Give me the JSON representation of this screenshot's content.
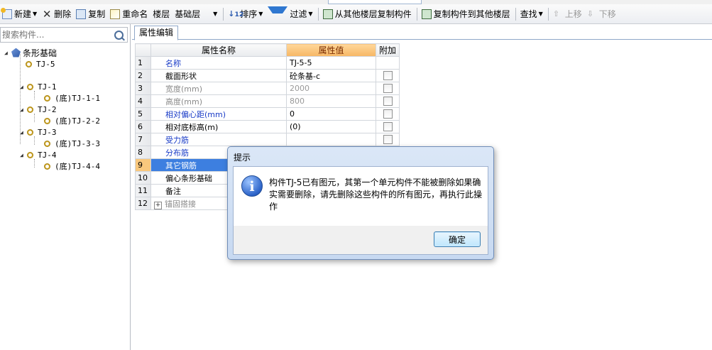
{
  "toolbar": {
    "new_label": "新建",
    "delete_label": "删除",
    "copy_label": "复制",
    "rename_label": "重命名",
    "floor_label": "楼层",
    "floor_value": "基础层",
    "sort_label": "排序",
    "filter_label": "过滤",
    "copy_from_label": "从其他楼层复制构件",
    "copy_to_label": "复制构件到其他楼层",
    "find_label": "查找",
    "up_label": "上移",
    "down_label": "下移"
  },
  "sidebar": {
    "search_placeholder": "搜索构件...",
    "root_label": "条形基础",
    "items": [
      {
        "label": "TJ-5"
      },
      {
        "label": "TJ-1",
        "child": "(底)TJ-1-1"
      },
      {
        "label": "TJ-2",
        "child": "(底)TJ-2-2"
      },
      {
        "label": "TJ-3",
        "child": "(底)TJ-3-3"
      },
      {
        "label": "TJ-4",
        "child": "(底)TJ-4-4"
      }
    ]
  },
  "main": {
    "tab_label": "属性编辑",
    "grid": {
      "headers": [
        "属性名称",
        "属性值",
        "附加"
      ],
      "rows": [
        {
          "num": "1",
          "name": "名称",
          "value": "TJ-5-5"
        },
        {
          "num": "2",
          "name": "截面形状",
          "value": "砼条基-c"
        },
        {
          "num": "3",
          "name": "宽度(mm)",
          "value": "2000"
        },
        {
          "num": "4",
          "name": "高度(mm)",
          "value": "800"
        },
        {
          "num": "5",
          "name": "相对偏心距(mm)",
          "value": "0"
        },
        {
          "num": "6",
          "name": "相对底标高(m)",
          "value": "(0)"
        },
        {
          "num": "7",
          "name": "受力筋",
          "value": ""
        },
        {
          "num": "8",
          "name": "分布筋",
          "value": ""
        },
        {
          "num": "9",
          "name": "其它钢筋",
          "value": ""
        },
        {
          "num": "10",
          "name": "偏心条形基础",
          "value": ""
        },
        {
          "num": "11",
          "name": "备注",
          "value": ""
        },
        {
          "num": "12",
          "name": "锚固搭接",
          "value": ""
        }
      ]
    }
  },
  "dialog": {
    "title": "提示",
    "message": "构件TJ-5已有图元，其第一个单元构件不能被删除如果确实需要删除，请先删除这些构件的所有图元，再执行此操作",
    "ok_label": "确定"
  },
  "colors": {
    "header_value_bg": "#f6b765",
    "selected_row": "#3d7fe0",
    "blue_text": "#1a3cc7",
    "dialog_frame": "#c7d9f1"
  }
}
